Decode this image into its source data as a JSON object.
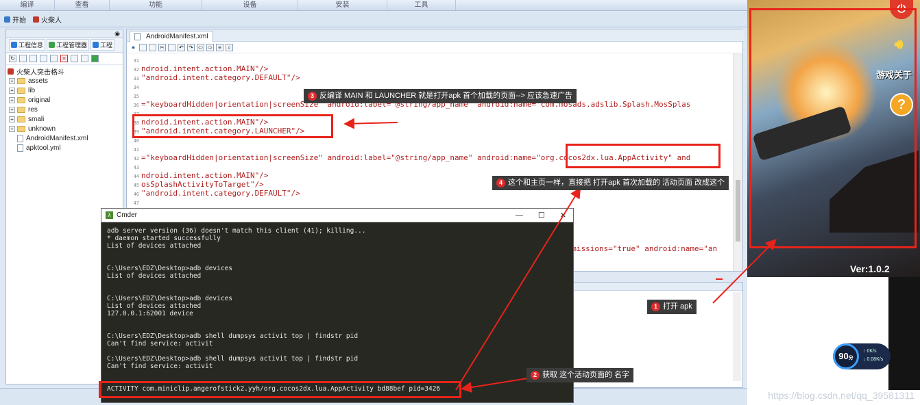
{
  "menubar": [
    "编译",
    "查看",
    "功能",
    "设备",
    "安装",
    "工具"
  ],
  "tabrow": {
    "start_label": "开始",
    "project_label": "火柴人"
  },
  "left_panel": {
    "tabs": [
      "工程信息",
      "工程管理器",
      "工程"
    ],
    "root_label": "火柴人突击格斗",
    "items": [
      {
        "label": "assets",
        "type": "folder"
      },
      {
        "label": "lib",
        "type": "folder"
      },
      {
        "label": "original",
        "type": "folder"
      },
      {
        "label": "res",
        "type": "folder"
      },
      {
        "label": "smali",
        "type": "folder"
      },
      {
        "label": "unknown",
        "type": "folder"
      },
      {
        "label": "AndroidManifest.xml",
        "type": "file"
      },
      {
        "label": "apktool.yml",
        "type": "file"
      }
    ]
  },
  "editor": {
    "tab_label": "AndroidManifest.xml",
    "lines": [
      {
        "n": "31",
        "t": ""
      },
      {
        "n": "32",
        "t": "ndroid.intent.action.MAIN\"/>"
      },
      {
        "n": "33",
        "t": "\"android.intent.category.DEFAULT\"/>"
      },
      {
        "n": "34",
        "t": ""
      },
      {
        "n": "35",
        "t": ""
      },
      {
        "n": "36",
        "t": "=\"keyboardHidden|orientation|screenSize\" android:label=\"@string/app_name\" android:name=\"com.mosads.adslib.Splash.MosSplas"
      },
      {
        "n": "37",
        "t": ""
      },
      {
        "n": "38",
        "t": "ndroid.intent.action.MAIN\"/>"
      },
      {
        "n": "39",
        "t": "\"android.intent.category.LAUNCHER\"/>"
      },
      {
        "n": "40",
        "t": ""
      },
      {
        "n": "41",
        "t": ""
      },
      {
        "n": "42",
        "t": "=\"keyboardHidden|orientation|screenSize\" android:label=\"@string/app_name\" android:name=\"org.cocos2dx.lua.AppActivity\" and"
      },
      {
        "n": "43",
        "t": ""
      },
      {
        "n": "44",
        "t": "ndroid.intent.action.MAIN\"/>"
      },
      {
        "n": "45",
        "t": "osSplashActivityToTarget\"/>"
      },
      {
        "n": "46",
        "t": "\"android.intent.category.DEFAULT\"/>"
      },
      {
        "n": "47",
        "t": ""
      }
    ],
    "hidden_tail": "ermissions=\"true\" android:name=\"an"
  },
  "cmder": {
    "title": "Cmder",
    "lines": [
      "adb server version (36) doesn't match this client (41); killing...",
      "* daemon started successfully",
      "List of devices attached",
      "",
      "",
      "C:\\Users\\EDZ\\Desktop>adb devices",
      "List of devices attached",
      "",
      "",
      "C:\\Users\\EDZ\\Desktop>adb devices",
      "List of devices attached",
      "127.0.0.1:62001 device",
      "",
      "",
      "C:\\Users\\EDZ\\Desktop>adb shell dumpsys activit top | findstr pid",
      "Can't find service: activit",
      "",
      "C:\\Users\\EDZ\\Desktop>adb shell dumpsys activit top | findstr pid",
      "Can't find service: activit",
      "",
      "",
      "  ACTIVITY com.miniclip.angerofstick2.yyh/org.cocos2dx.lua.AppActivity bd88bef pid=3426"
    ]
  },
  "game": {
    "about_label": "游戏关于",
    "version": "Ver:1.0.2"
  },
  "annotations": {
    "c1": {
      "num": "1",
      "text": "打开 apk"
    },
    "c2": {
      "num": "2",
      "text": "获取 这个活动页面的 名字"
    },
    "c3": {
      "num": "3",
      "text": "反编译 MAIN 和 LAUNCHER 就是打开apk 首个加载的页面--> 应该急速广告"
    },
    "c4": {
      "num": "4",
      "text": "这个和主页一样，直接把 打开apk 首次加载的 活动页面 改成这个"
    }
  },
  "speed": {
    "value": "90",
    "unit": "分",
    "up": "0K/s",
    "down": "0.08K/s"
  },
  "watermark": "https://blog.csdn.net/qq_39581311",
  "colors": {
    "annotation_red": "#e8231a",
    "callout_bg": "#3b3b3b",
    "terminal_bg": "#272822"
  }
}
